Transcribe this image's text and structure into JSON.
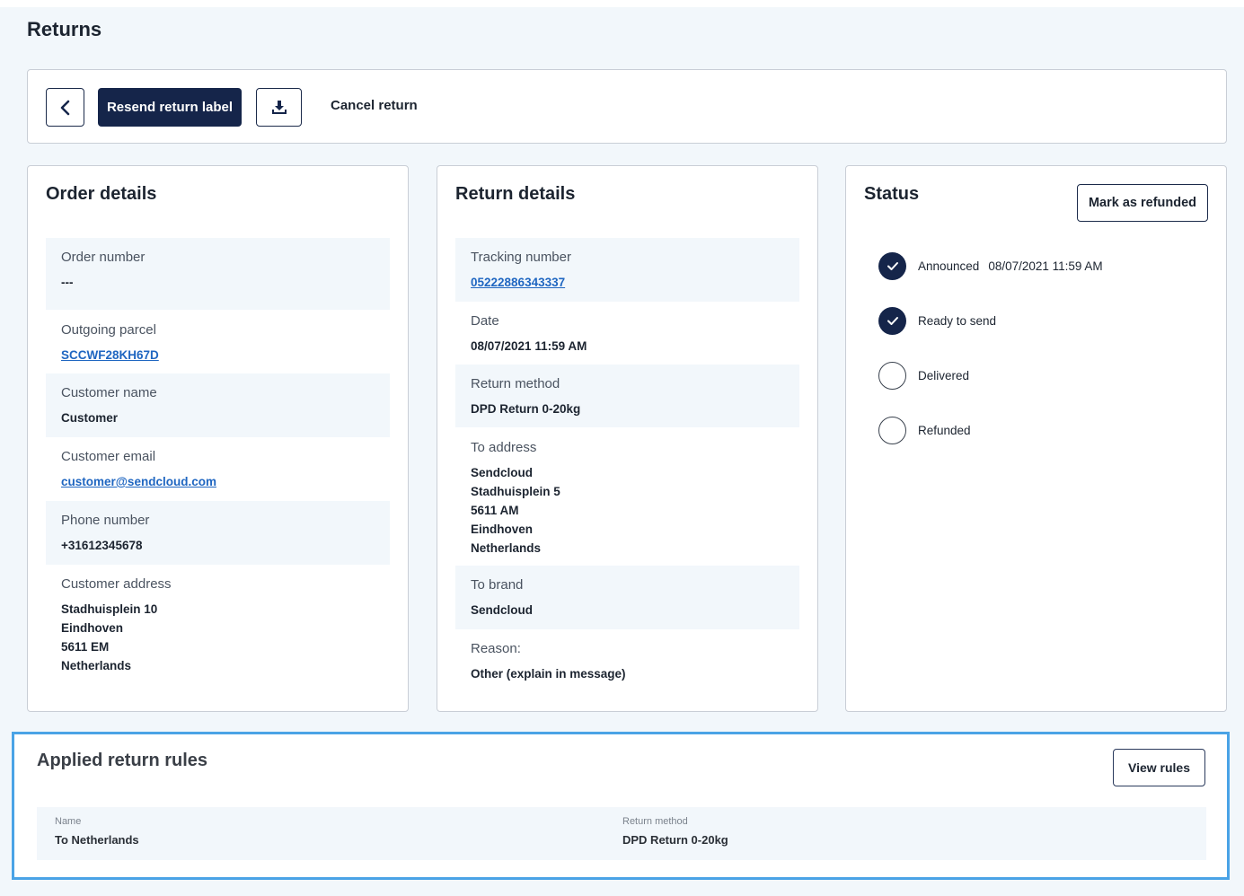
{
  "page": {
    "title": "Returns"
  },
  "toolbar": {
    "resend_label": "Resend return label",
    "cancel_label": "Cancel return"
  },
  "order_details": {
    "title": "Order details",
    "order_number": {
      "label": "Order number",
      "value": "---"
    },
    "outgoing_parcel": {
      "label": "Outgoing parcel",
      "value": "SCCWF28KH67D"
    },
    "customer_name": {
      "label": "Customer name",
      "value": "Customer"
    },
    "customer_email": {
      "label": "Customer email",
      "value": "customer@sendcloud.com"
    },
    "phone_number": {
      "label": "Phone number",
      "value": "+31612345678"
    },
    "customer_address": {
      "label": "Customer address",
      "lines": [
        "Stadhuisplein 10",
        "Eindhoven",
        "5611 EM",
        "Netherlands"
      ]
    }
  },
  "return_details": {
    "title": "Return details",
    "tracking_number": {
      "label": "Tracking number",
      "value": "05222886343337"
    },
    "date": {
      "label": "Date",
      "value": "08/07/2021 11:59 AM"
    },
    "return_method": {
      "label": "Return method",
      "value": "DPD Return 0-20kg"
    },
    "to_address": {
      "label": "To address",
      "lines": [
        "Sendcloud",
        "Stadhuisplein 5",
        "5611 AM",
        "Eindhoven",
        "Netherlands"
      ]
    },
    "to_brand": {
      "label": "To brand",
      "value": "Sendcloud"
    },
    "reason": {
      "label": "Reason:",
      "value": "Other (explain in message)"
    }
  },
  "status": {
    "title": "Status",
    "refund_button": "Mark as refunded",
    "steps": [
      {
        "label": "Announced",
        "time": "08/07/2021 11:59 AM",
        "done": true
      },
      {
        "label": "Ready to send",
        "time": "",
        "done": true
      },
      {
        "label": "Delivered",
        "time": "",
        "done": false
      },
      {
        "label": "Refunded",
        "time": "",
        "done": false
      }
    ]
  },
  "rules": {
    "title": "Applied return rules",
    "view_button": "View rules",
    "name_label": "Name",
    "name_value": "To Netherlands",
    "method_label": "Return method",
    "method_value": "DPD Return 0-20kg"
  },
  "colors": {
    "primary": "#15254a",
    "link": "#1f66c1",
    "highlight_border": "#4aa3e6",
    "shaded_bg": "#f2f7fb"
  }
}
